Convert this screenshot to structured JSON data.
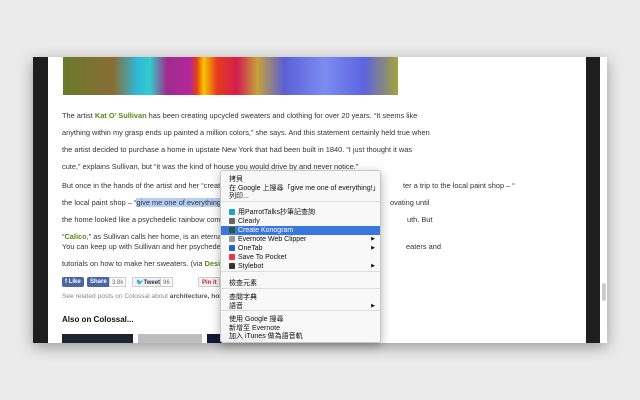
{
  "article": {
    "p1": {
      "pre": "The artist ",
      "link": "Kat O’ Sullivan",
      "post": " has been creating upcycled sweaters and clothing for over 20 years. “It seems like anything within my grasp ends up painted a million colors,” she says. And this statement certainly held true when the artist decided to purchase a home in upstate New York that had been built in 1840. “I just thought it was cute,” explains Sullivan, but “it was the kind of house you would drive by and never notice.”"
    },
    "p2": {
      "pre": "But once in the hands of the artist and her “creat",
      "mid": "ter a trip to the local paint shop – “",
      "selected": "give me one of everything!",
      "post": "",
      "l3": "the home looked like a psychedelic rainbow comp",
      "l3b": "ovating until",
      "l3c": "uth. But",
      "l4a": "“",
      "l4link": "Calico",
      "l4b": ",” as Sullivan calls her home, is an eternal w"
    },
    "p3": {
      "l1": "You can keep up with Sullivan and her psychedelic",
      "l1b": "eaters and",
      "l2": "tutorials on how to make her sweaters. (via ",
      "l2link": "Desig"
    }
  },
  "share": {
    "like": "Like",
    "share": "Share",
    "share_count": "3.8k",
    "tweet": "Tweet",
    "tweet_count": "96",
    "pin": "Pin it",
    "pin_count": "73"
  },
  "related": {
    "text": "See related posts on Colossal about ",
    "tags": "architecture, hom"
  },
  "also": {
    "title": "Also on Colossal..."
  },
  "menu": {
    "items": [
      {
        "label": "拷貝"
      },
      {
        "label": "在 Google 上搜尋「give me one of everything!」"
      },
      {
        "label": "列印..."
      },
      {
        "label": "用ParrotTalks抄筆記查詢",
        "icon": "parrottalks-icon"
      },
      {
        "label": "Clearly",
        "icon": "clearly-icon"
      },
      {
        "label": "Create Konogram",
        "icon": "konogram-icon",
        "highlighted": true
      },
      {
        "label": "Evernote Web Clipper",
        "icon": "evernote-icon",
        "submenu": true
      },
      {
        "label": "OneTab",
        "icon": "onetab-icon",
        "submenu": true
      },
      {
        "label": "Save To Pocket",
        "icon": "pocket-icon"
      },
      {
        "label": "Stylebot",
        "icon": "stylebot-icon",
        "submenu": true
      },
      {
        "label": "檢查元素"
      },
      {
        "label": "查閱字典"
      },
      {
        "label": "語音",
        "submenu": true
      },
      {
        "label": "使用 Google 搜尋"
      },
      {
        "label": "新增至 Evernote"
      },
      {
        "label": "加入 iTunes 做為語音軌"
      }
    ]
  },
  "colors": {
    "link": "#5a8a1a",
    "highlight": "#3a77dc",
    "selection": "#b5cff2"
  }
}
